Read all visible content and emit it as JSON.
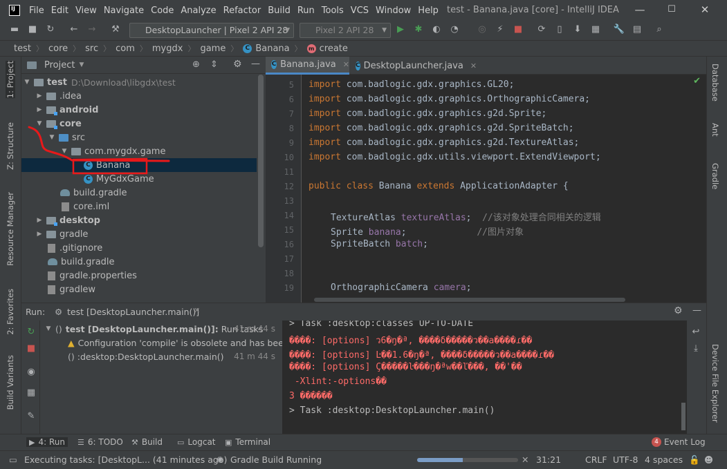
{
  "window": {
    "title": "test - Banana.java [core] - IntelliJ IDEA",
    "minimize": "—",
    "maximize": "☐",
    "close": "✕"
  },
  "menu": [
    "File",
    "Edit",
    "View",
    "Navigate",
    "Code",
    "Analyze",
    "Refactor",
    "Build",
    "Run",
    "Tools",
    "VCS",
    "Window",
    "Help"
  ],
  "toolbar": {
    "run_config": "DesktopLauncher | Pixel 2 API 28",
    "device": "Pixel 2 API 28"
  },
  "breadcrumb": [
    "test",
    "core",
    "src",
    "com",
    "mygdx",
    "game",
    "Banana",
    "create"
  ],
  "left_tool_tabs": [
    "1: Project",
    "Z: Structure",
    "Resource Manager",
    "2: Favorites",
    "Build Variants"
  ],
  "right_tool_tabs": [
    "Database",
    "Ant",
    "Gradle",
    "Device File Explorer"
  ],
  "project": {
    "header": "Project",
    "tree": [
      {
        "label": "test",
        "hint": "D:\\Download\\libgdx\\test",
        "bold": true
      },
      {
        "label": ".idea"
      },
      {
        "label": "android",
        "bold": true
      },
      {
        "label": "core",
        "bold": true
      },
      {
        "label": "src"
      },
      {
        "label": "com.mygdx.game"
      },
      {
        "label": "Banana"
      },
      {
        "label": "MyGdxGame"
      },
      {
        "label": "build.gradle"
      },
      {
        "label": "core.iml"
      },
      {
        "label": "desktop",
        "bold": true
      },
      {
        "label": "gradle"
      },
      {
        "label": ".gitignore"
      },
      {
        "label": "build.gradle"
      },
      {
        "label": "gradle.properties"
      },
      {
        "label": "gradlew"
      }
    ]
  },
  "editor": {
    "tabs": [
      {
        "label": "Banana.java",
        "active": true
      },
      {
        "label": "DesktopLauncher.java",
        "active": false
      }
    ],
    "line_numbers": [
      "5",
      "6",
      "7",
      "8",
      "9",
      "10",
      "11",
      "12",
      "13",
      "14",
      "15",
      "16",
      "17",
      "18",
      "19"
    ],
    "imports": [
      "com.badlogic.gdx.graphics.GL20;",
      "com.badlogic.gdx.graphics.OrthographicCamera;",
      "com.badlogic.gdx.graphics.g2d.Sprite;",
      "com.badlogic.gdx.graphics.g2d.SpriteBatch;",
      "com.badlogic.gdx.graphics.g2d.TextureAtlas;",
      "com.badlogic.gdx.utils.viewport.ExtendViewport;"
    ],
    "kw_import": "import",
    "kw_public_class": "public class",
    "class_name": "Banana",
    "kw_extends": "extends",
    "super_class": "ApplicationAdapter {",
    "field1_type": "TextureAtlas",
    "field1_name": "textureAtlas",
    "field1_comment": "//该对象处理合同相关的逻辑",
    "field2_type": "Sprite",
    "field2_name": "banana",
    "field2_comment": "//图片对象",
    "field3_type": "SpriteBatch",
    "field3_name": "batch",
    "field4_type": "OrthographicCamera",
    "field4_name": "camera",
    "semicolon": ";"
  },
  "run": {
    "label": "Run:",
    "tab": "test [DesktopLauncher.main()]",
    "tree": [
      {
        "label": "test [DesktopLauncher.main()]:",
        "suffix": "Run tasks",
        "time": "41 m 44 s"
      },
      {
        "label": "Configuration 'compile' is obsolete and has been",
        "time": ""
      },
      {
        "label": ":desktop:DesktopLauncher.main()",
        "time": "41 m 44 s"
      }
    ],
    "console": [
      {
        "text": "> Task :desktop:classes UP-TO-DATE",
        "err": false
      },
      {
        "text": "����: [options] ว6�ŋ�ª, ����δ�����ว��а����ɾ��",
        "err": true
      },
      {
        "text": "����: [options] Ŀ��1.6�ŋ�ª, ����δ�����ว��а����ɾ��",
        "err": true
      },
      {
        "text": "����: [options] Ç�����ŀ���ŋ�ªw��ľ���, ��'��",
        "err": true
      },
      {
        "text": " -Xlint:-options��",
        "err": true
      },
      {
        "text": "3 ������",
        "err": true
      },
      {
        "text": "> Task :desktop:DesktopLauncher.main()",
        "err": false
      }
    ]
  },
  "bottom_tabs": [
    {
      "label": "4: Run",
      "icon": "run-icon"
    },
    {
      "label": "6: TODO",
      "icon": "todo-icon"
    },
    {
      "label": "Build",
      "icon": "build-icon"
    },
    {
      "label": "Logcat",
      "icon": "logcat-icon"
    },
    {
      "label": "Terminal",
      "icon": "terminal-icon"
    }
  ],
  "event_log": {
    "label": "Event Log",
    "count": "4"
  },
  "status": {
    "message": "Executing tasks: [DesktopL... (41 minutes ago)",
    "gradle": "Gradle Build Running",
    "position": "31:21",
    "line_sep": "CRLF",
    "encoding": "UTF-8",
    "indent": "4 spaces",
    "progress": 0.45
  },
  "colors": {
    "accent": "#4a88c7",
    "annotation": "#e8191a",
    "selection": "#0d293e",
    "error_text": "#ff6b68"
  }
}
